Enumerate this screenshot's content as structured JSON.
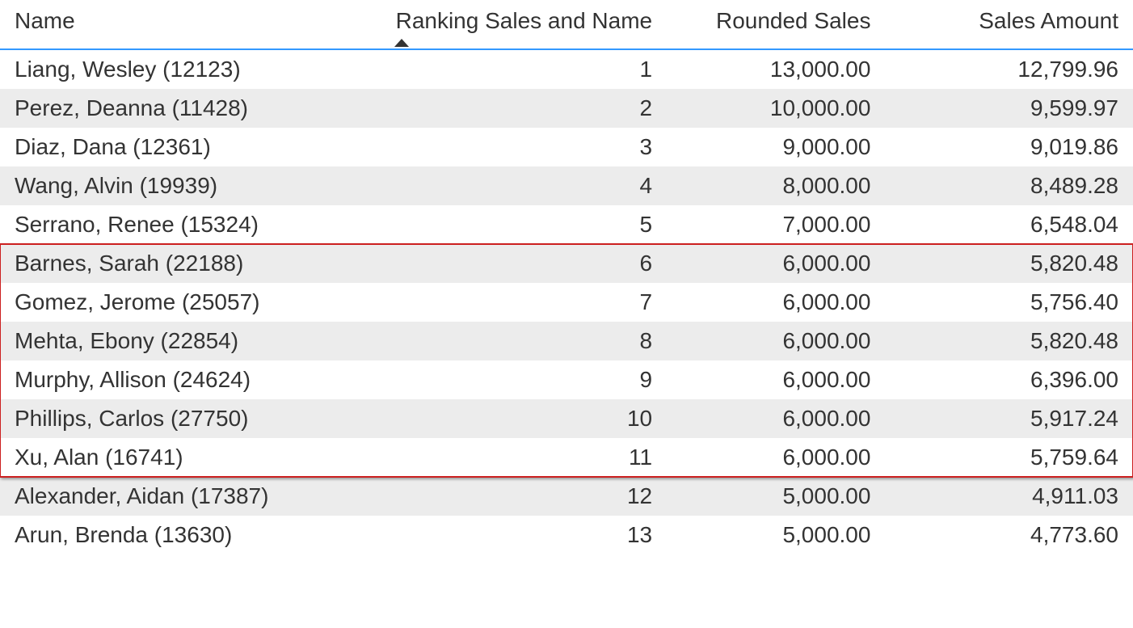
{
  "columns": {
    "name": "Name",
    "ranking": "Ranking Sales and Name",
    "rounded": "Rounded Sales",
    "sales": "Sales Amount"
  },
  "sortedColumn": "ranking",
  "sortDirection": "asc",
  "highlightRange": {
    "start": 5,
    "end": 10
  },
  "rows": [
    {
      "name": "Liang, Wesley (12123)",
      "ranking": "1",
      "rounded": "13,000.00",
      "sales": "12,799.96"
    },
    {
      "name": "Perez, Deanna (11428)",
      "ranking": "2",
      "rounded": "10,000.00",
      "sales": "9,599.97"
    },
    {
      "name": "Diaz, Dana (12361)",
      "ranking": "3",
      "rounded": "9,000.00",
      "sales": "9,019.86"
    },
    {
      "name": "Wang, Alvin (19939)",
      "ranking": "4",
      "rounded": "8,000.00",
      "sales": "8,489.28"
    },
    {
      "name": "Serrano, Renee (15324)",
      "ranking": "5",
      "rounded": "7,000.00",
      "sales": "6,548.04"
    },
    {
      "name": "Barnes, Sarah (22188)",
      "ranking": "6",
      "rounded": "6,000.00",
      "sales": "5,820.48"
    },
    {
      "name": "Gomez, Jerome (25057)",
      "ranking": "7",
      "rounded": "6,000.00",
      "sales": "5,756.40"
    },
    {
      "name": "Mehta, Ebony (22854)",
      "ranking": "8",
      "rounded": "6,000.00",
      "sales": "5,820.48"
    },
    {
      "name": "Murphy, Allison (24624)",
      "ranking": "9",
      "rounded": "6,000.00",
      "sales": "6,396.00"
    },
    {
      "name": "Phillips, Carlos (27750)",
      "ranking": "10",
      "rounded": "6,000.00",
      "sales": "5,917.24"
    },
    {
      "name": "Xu, Alan (16741)",
      "ranking": "11",
      "rounded": "6,000.00",
      "sales": "5,759.64"
    },
    {
      "name": "Alexander, Aidan (17387)",
      "ranking": "12",
      "rounded": "5,000.00",
      "sales": "4,911.03"
    },
    {
      "name": "Arun, Brenda (13630)",
      "ranking": "13",
      "rounded": "5,000.00",
      "sales": "4,773.60"
    }
  ]
}
